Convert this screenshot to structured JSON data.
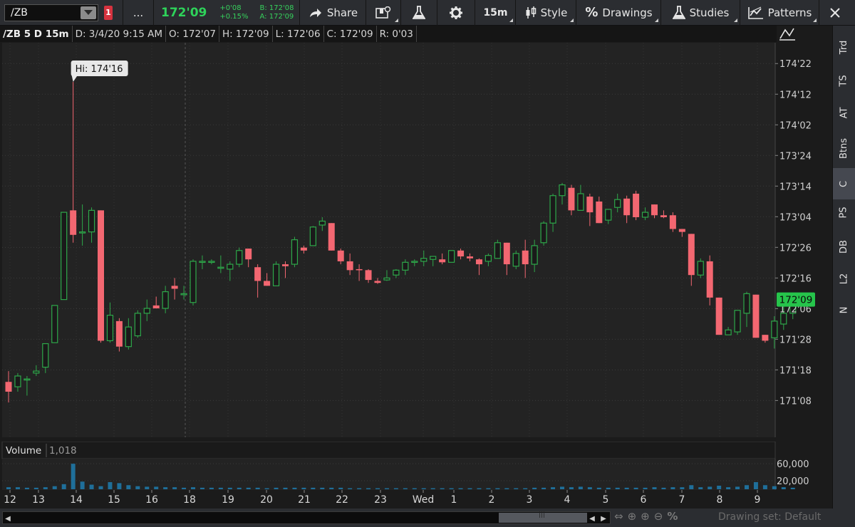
{
  "toolbar": {
    "symbol": "/ZB",
    "link_badge": "1",
    "more_label": "...",
    "last_price": "172'09",
    "net_change": "+0'08",
    "pct_change": "+0.15%",
    "bid": "B: 172'08",
    "ask": "A: 172'09",
    "share_label": "Share",
    "timeframe": "15m",
    "style_label": "Style",
    "drawings_label": "Drawings",
    "studies_label": "Studies",
    "patterns_label": "Patterns"
  },
  "info": {
    "title": "/ZB 5 D 15m",
    "date": "D: 3/4/20 9:15 AM",
    "open": "O: 172'07",
    "high": "H: 172'09",
    "low": "L: 172'06",
    "close": "C: 172'09",
    "range": "R: 0'03"
  },
  "hi_label": "Hi: 174'16",
  "current_price_tag": "172'09",
  "price_ticks": [
    "174'22",
    "174'12",
    "174'02",
    "173'24",
    "173'14",
    "173'04",
    "172'26",
    "172'16",
    "172'06",
    "171'28",
    "171'18",
    "171'08"
  ],
  "volume_label": "Volume",
  "volume_value": "1,018",
  "volume_ticks": [
    "60,000",
    "20,000"
  ],
  "time_labels": [
    "12",
    "13",
    "14",
    "15",
    "16",
    "18",
    "19",
    "20",
    "21",
    "22",
    "23",
    "Wed",
    "1",
    "2",
    "3",
    "4",
    "5",
    "6",
    "7",
    "8",
    "9"
  ],
  "side_tabs": [
    "Trd",
    "TS",
    "AT",
    "Btns",
    "C",
    "PS",
    "DB",
    "L2",
    "N"
  ],
  "drawing_set": "Drawing set: Default",
  "colors": {
    "up": "#2ea84a",
    "down": "#f36771",
    "background": "#1b1b1b",
    "accent": "#2ed35a",
    "volume": "#1f6f9a"
  },
  "chart_data": {
    "type": "candlestick",
    "price_unit": "32nds (172'09 = 172 + 9/32)",
    "ylim": [
      170.875,
      174.9
    ],
    "candles": [
      {
        "o": 171.44,
        "h": 171.55,
        "l": 171.23,
        "c": 171.34
      },
      {
        "o": 171.39,
        "h": 171.53,
        "l": 171.34,
        "c": 171.5
      },
      {
        "o": 171.47,
        "h": 171.5,
        "l": 171.3,
        "c": 171.47
      },
      {
        "o": 171.53,
        "h": 171.61,
        "l": 171.5,
        "c": 171.55
      },
      {
        "o": 171.59,
        "h": 171.83,
        "l": 171.53,
        "c": 171.83
      },
      {
        "o": 171.84,
        "h": 172.22,
        "l": 171.84,
        "c": 172.22
      },
      {
        "o": 172.28,
        "h": 173.17,
        "l": 172.28,
        "c": 173.17
      },
      {
        "o": 173.19,
        "h": 174.5,
        "l": 172.86,
        "c": 172.94
      },
      {
        "o": 172.97,
        "h": 173.25,
        "l": 172.83,
        "c": 172.97
      },
      {
        "o": 172.97,
        "h": 173.22,
        "l": 172.86,
        "c": 173.19
      },
      {
        "o": 173.19,
        "h": 173.19,
        "l": 171.84,
        "c": 171.86
      },
      {
        "o": 171.86,
        "h": 172.25,
        "l": 171.84,
        "c": 172.12
      },
      {
        "o": 172.06,
        "h": 172.09,
        "l": 171.75,
        "c": 171.8
      },
      {
        "o": 171.8,
        "h": 172.09,
        "l": 171.77,
        "c": 172.0
      },
      {
        "o": 171.91,
        "h": 172.17,
        "l": 171.89,
        "c": 172.14
      },
      {
        "o": 172.14,
        "h": 172.28,
        "l": 172.06,
        "c": 172.19
      },
      {
        "o": 172.22,
        "h": 172.31,
        "l": 172.19,
        "c": 172.19
      },
      {
        "o": 172.19,
        "h": 172.42,
        "l": 172.14,
        "c": 172.36
      },
      {
        "o": 172.42,
        "h": 172.5,
        "l": 172.28,
        "c": 172.39
      },
      {
        "o": 172.34,
        "h": 172.42,
        "l": 172.28,
        "c": 172.34
      },
      {
        "o": 172.25,
        "h": 172.69,
        "l": 172.22,
        "c": 172.67
      },
      {
        "o": 172.67,
        "h": 172.73,
        "l": 172.59,
        "c": 172.67
      },
      {
        "o": 172.67,
        "h": 172.69,
        "l": 172.64,
        "c": 172.67
      },
      {
        "o": 172.61,
        "h": 172.73,
        "l": 172.55,
        "c": 172.61
      },
      {
        "o": 172.59,
        "h": 172.67,
        "l": 172.47,
        "c": 172.64
      },
      {
        "o": 172.64,
        "h": 172.81,
        "l": 172.61,
        "c": 172.78
      },
      {
        "o": 172.8,
        "h": 172.8,
        "l": 172.61,
        "c": 172.69
      },
      {
        "o": 172.61,
        "h": 172.64,
        "l": 172.3,
        "c": 172.47
      },
      {
        "o": 172.47,
        "h": 172.55,
        "l": 172.42,
        "c": 172.42
      },
      {
        "o": 172.42,
        "h": 172.67,
        "l": 172.42,
        "c": 172.64
      },
      {
        "o": 172.64,
        "h": 172.67,
        "l": 172.5,
        "c": 172.62
      },
      {
        "o": 172.64,
        "h": 172.92,
        "l": 172.61,
        "c": 172.89
      },
      {
        "o": 172.81,
        "h": 172.83,
        "l": 172.75,
        "c": 172.78
      },
      {
        "o": 172.83,
        "h": 173.03,
        "l": 172.83,
        "c": 173.02
      },
      {
        "o": 173.04,
        "h": 173.12,
        "l": 172.98,
        "c": 173.08
      },
      {
        "o": 173.06,
        "h": 173.06,
        "l": 172.78,
        "c": 172.78
      },
      {
        "o": 172.78,
        "h": 172.8,
        "l": 172.64,
        "c": 172.67
      },
      {
        "o": 172.67,
        "h": 172.75,
        "l": 172.53,
        "c": 172.58
      },
      {
        "o": 172.59,
        "h": 172.64,
        "l": 172.47,
        "c": 172.58
      },
      {
        "o": 172.58,
        "h": 172.59,
        "l": 172.45,
        "c": 172.48
      },
      {
        "o": 172.47,
        "h": 172.5,
        "l": 172.44,
        "c": 172.45
      },
      {
        "o": 172.48,
        "h": 172.58,
        "l": 172.47,
        "c": 172.5
      },
      {
        "o": 172.53,
        "h": 172.59,
        "l": 172.5,
        "c": 172.58
      },
      {
        "o": 172.58,
        "h": 172.69,
        "l": 172.53,
        "c": 172.66
      },
      {
        "o": 172.66,
        "h": 172.69,
        "l": 172.62,
        "c": 172.67
      },
      {
        "o": 172.67,
        "h": 172.78,
        "l": 172.62,
        "c": 172.7
      },
      {
        "o": 172.69,
        "h": 172.72,
        "l": 172.62,
        "c": 172.72
      },
      {
        "o": 172.69,
        "h": 172.75,
        "l": 172.64,
        "c": 172.66
      },
      {
        "o": 172.66,
        "h": 172.78,
        "l": 172.66,
        "c": 172.78
      },
      {
        "o": 172.78,
        "h": 172.8,
        "l": 172.69,
        "c": 172.72
      },
      {
        "o": 172.72,
        "h": 172.75,
        "l": 172.67,
        "c": 172.7
      },
      {
        "o": 172.69,
        "h": 172.7,
        "l": 172.53,
        "c": 172.64
      },
      {
        "o": 172.67,
        "h": 172.75,
        "l": 172.62,
        "c": 172.73
      },
      {
        "o": 172.7,
        "h": 172.89,
        "l": 172.7,
        "c": 172.86
      },
      {
        "o": 172.86,
        "h": 172.86,
        "l": 172.53,
        "c": 172.64
      },
      {
        "o": 172.62,
        "h": 172.78,
        "l": 172.59,
        "c": 172.75
      },
      {
        "o": 172.78,
        "h": 172.89,
        "l": 172.5,
        "c": 172.64
      },
      {
        "o": 172.64,
        "h": 172.89,
        "l": 172.56,
        "c": 172.83
      },
      {
        "o": 172.86,
        "h": 173.08,
        "l": 172.83,
        "c": 173.06
      },
      {
        "o": 173.06,
        "h": 173.36,
        "l": 172.97,
        "c": 173.34
      },
      {
        "o": 173.34,
        "h": 173.47,
        "l": 173.25,
        "c": 173.45
      },
      {
        "o": 173.42,
        "h": 173.45,
        "l": 173.14,
        "c": 173.19
      },
      {
        "o": 173.19,
        "h": 173.45,
        "l": 173.19,
        "c": 173.36
      },
      {
        "o": 173.33,
        "h": 173.36,
        "l": 173.03,
        "c": 173.17
      },
      {
        "o": 173.28,
        "h": 173.33,
        "l": 173.06,
        "c": 173.06
      },
      {
        "o": 173.09,
        "h": 173.2,
        "l": 173.05,
        "c": 173.2
      },
      {
        "o": 173.22,
        "h": 173.36,
        "l": 173.17,
        "c": 173.3
      },
      {
        "o": 173.31,
        "h": 173.34,
        "l": 173.06,
        "c": 173.14
      },
      {
        "o": 173.36,
        "h": 173.39,
        "l": 173.09,
        "c": 173.12
      },
      {
        "o": 173.12,
        "h": 173.22,
        "l": 173.09,
        "c": 173.17
      },
      {
        "o": 173.25,
        "h": 173.25,
        "l": 173.11,
        "c": 173.14
      },
      {
        "o": 173.14,
        "h": 173.19,
        "l": 173.11,
        "c": 173.12
      },
      {
        "o": 173.14,
        "h": 173.17,
        "l": 172.97,
        "c": 173.0
      },
      {
        "o": 173.0,
        "h": 173.0,
        "l": 172.92,
        "c": 172.97
      },
      {
        "o": 172.95,
        "h": 172.95,
        "l": 172.42,
        "c": 172.53
      },
      {
        "o": 172.53,
        "h": 172.7,
        "l": 172.5,
        "c": 172.67
      },
      {
        "o": 172.67,
        "h": 172.73,
        "l": 172.22,
        "c": 172.3
      },
      {
        "o": 172.3,
        "h": 172.3,
        "l": 171.92,
        "c": 171.92
      },
      {
        "o": 171.92,
        "h": 172.0,
        "l": 171.92,
        "c": 171.97
      },
      {
        "o": 171.95,
        "h": 172.17,
        "l": 171.92,
        "c": 172.17
      },
      {
        "o": 172.14,
        "h": 172.36,
        "l": 172.0,
        "c": 172.34
      },
      {
        "o": 172.33,
        "h": 172.33,
        "l": 171.89,
        "c": 171.89
      },
      {
        "o": 171.92,
        "h": 171.92,
        "l": 171.84,
        "c": 171.86
      },
      {
        "o": 171.89,
        "h": 172.11,
        "l": 171.78,
        "c": 172.06
      },
      {
        "o": 172.03,
        "h": 172.22,
        "l": 171.97,
        "c": 172.14
      },
      {
        "o": 172.14,
        "h": 172.25,
        "l": 172.08,
        "c": 172.28
      }
    ],
    "volume": [
      4,
      4,
      3,
      3,
      4,
      6,
      10,
      50,
      15,
      9,
      6,
      14,
      12,
      8,
      6,
      5,
      5,
      4,
      4,
      3,
      4,
      3,
      3,
      3,
      3,
      3,
      3,
      3,
      2,
      3,
      3,
      3,
      3,
      3,
      3,
      3,
      3,
      2,
      2,
      2,
      2,
      2,
      2,
      2,
      2,
      2,
      2,
      2,
      2,
      2,
      2,
      2,
      2,
      2,
      2,
      2,
      2,
      3,
      3,
      4,
      5,
      4,
      5,
      4,
      3,
      3,
      3,
      3,
      3,
      3,
      4,
      3,
      4,
      4,
      8,
      4,
      5,
      7,
      4,
      5,
      8,
      14,
      8,
      6,
      4,
      3
    ],
    "volume_ylim": [
      0,
      72000
    ]
  }
}
